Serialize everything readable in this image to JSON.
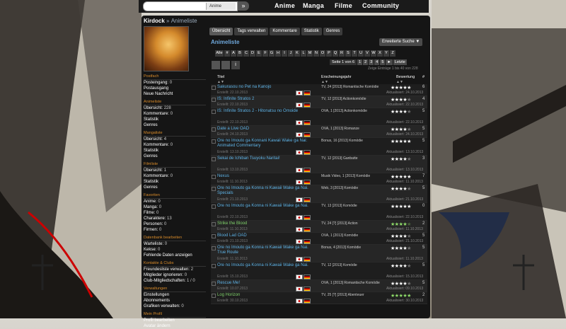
{
  "search": {
    "select_value": "Anime",
    "button_icon": "double-chevron-right-icon"
  },
  "nav": {
    "items": [
      "Anime",
      "Manga",
      "Filme",
      "Community"
    ]
  },
  "user": {
    "name": "Kirdock",
    "separator": "»",
    "page": "Animeliste"
  },
  "sidebar": {
    "sections": [
      {
        "title": "Postfach",
        "lines": [
          {
            "label": "Posteingang:",
            "value": "0"
          },
          {
            "label": "Postausgang",
            "value": ""
          },
          {
            "label": "Neue Nachricht",
            "value": ""
          }
        ]
      },
      {
        "title": "Animeliste",
        "lines": [
          {
            "label": "Übersicht:",
            "value": "228"
          },
          {
            "label": "Kommentare:",
            "value": "0"
          },
          {
            "label": "Statistik",
            "value": ""
          },
          {
            "label": "Genres",
            "value": ""
          }
        ]
      },
      {
        "title": "Mangaliste",
        "lines": [
          {
            "label": "Übersicht:",
            "value": "4"
          },
          {
            "label": "Kommentare:",
            "value": "0"
          },
          {
            "label": "Statistik",
            "value": ""
          },
          {
            "label": "Genres",
            "value": ""
          }
        ]
      },
      {
        "title": "Filmliste",
        "lines": [
          {
            "label": "Übersicht:",
            "value": "1"
          },
          {
            "label": "Kommentare:",
            "value": "0"
          },
          {
            "label": "Statistik",
            "value": ""
          },
          {
            "label": "Genres",
            "value": ""
          }
        ]
      },
      {
        "title": "Favoriten",
        "lines": [
          {
            "label": "Anime:",
            "value": "0"
          },
          {
            "label": "Manga:",
            "value": "0"
          },
          {
            "label": "Filme:",
            "value": "0"
          },
          {
            "label": "Charaktere:",
            "value": "13"
          },
          {
            "label": "Personen:",
            "value": "0"
          },
          {
            "label": "Firmen:",
            "value": "0"
          }
        ]
      },
      {
        "title": "Datenbank bearbeiten",
        "lines": [
          {
            "label": "Warteliste:",
            "value": "0"
          },
          {
            "label": "Kekse:",
            "value": "0"
          },
          {
            "label": "Fehlende Daten anzeigen",
            "value": ""
          }
        ]
      },
      {
        "title": "Kontakte & Clubs",
        "lines": [
          {
            "label": "Freundesliste verwalten:",
            "value": "2"
          },
          {
            "label": "Mitglieder ignorieren:",
            "value": "0"
          },
          {
            "label": "Club-Mitgliedschaften:",
            "value": "1 / 0"
          }
        ]
      },
      {
        "title": "Verwaltungen",
        "lines": [
          {
            "label": "Einstellungen",
            "value": ""
          },
          {
            "label": "Abonnements",
            "value": ""
          },
          {
            "label": "Grafiken verwalten:",
            "value": "0"
          }
        ]
      },
      {
        "title": "Mein Profil",
        "lines": [
          {
            "label": "Profil bearbeiten",
            "value": ""
          },
          {
            "label": "Avatar ändern",
            "value": ""
          }
        ]
      }
    ]
  },
  "tabs": [
    "Übersicht",
    "Tags verwalten",
    "Kommentare",
    "Statistik",
    "Genres"
  ],
  "heading": "Animeliste",
  "advanced_search": "Erweiterte Suche ▼",
  "letters": [
    "Alle",
    "#",
    "A",
    "B",
    "C",
    "D",
    "E",
    "F",
    "G",
    "H",
    "I",
    "J",
    "K",
    "L",
    "M",
    "N",
    "O",
    "P",
    "Q",
    "R",
    "S",
    "T",
    "U",
    "V",
    "W",
    "X",
    "Y",
    "Z"
  ],
  "pager": {
    "label": "Seite 1 von 6",
    "pages": [
      "1",
      "2",
      "3",
      "4",
      "5"
    ],
    "next": "►",
    "last": "Letzte"
  },
  "entries_info": "Zeige Einträge 1 bis 40 von 228",
  "table_headers": {
    "title": "Titel",
    "release": "Erscheinungsjahr",
    "rating": "Bewertung",
    "num": "#"
  },
  "rows": [
    {
      "title": "Sakurasou no Pet na Kanojo",
      "meta": "Erstellt: 22.10.2013",
      "info": "TV, 24 [2013] Romantische Komödie",
      "stars": 5,
      "num": "6",
      "updated": "Aktualisiert: 24.10.2013",
      "green": false
    },
    {
      "title": "IS: Infinite Stratos 2",
      "meta": "Erstellt: 22.10.2013",
      "info": "TV, 12 [2013] Actionkomödie",
      "stars": 4,
      "num": "4",
      "updated": "Aktualisiert: 22.10.2013",
      "green": false
    },
    {
      "title": "IS: Infinite Stratos 2 - Hitonatsu no Omoide",
      "meta": "Erstellt: 22.10.2013",
      "info": "OVA, 1 [2013] Actionkomödie",
      "stars": 4,
      "num": "5",
      "updated": "Aktualisiert: 22.10.2013",
      "green": false
    },
    {
      "title": "Date a Live OAD",
      "meta": "Erstellt: 24.10.2013",
      "info": "OVA, 1 [2013] Romanze",
      "stars": 4,
      "num": "5",
      "updated": "Aktualisiert: 24.10.2013",
      "green": false
    },
    {
      "title": "Ore no Imouto ga Konnani Kawaii Wake ga Nai: Animated Commentary",
      "meta": "Erstellt: 13.10.2013",
      "info": "Bonus, 16 [2013] Komödie",
      "stars": 5,
      "num": "5",
      "updated": "Aktualisiert: 13.10.2013",
      "green": false
    },
    {
      "title": "Sekai de Ichiban Tsuyoku Naritai!",
      "meta": "Erstellt: 13.10.2013",
      "info": "TV, 12 [2013] Ganbatte",
      "stars": 4,
      "num": "3",
      "updated": "Aktualisiert: 13.10.2013",
      "green": false
    },
    {
      "title": "Nexus",
      "meta": "Erstellt: 11.10.2013",
      "info": "Musik Video, 1 [2013] Komödie",
      "stars": 5,
      "num": "7",
      "updated": "Aktualisiert: 11.10.2013",
      "green": false
    },
    {
      "title": "Ore no Imouto ga Konna ni Kawaii Wake ga Nai. Specials",
      "meta": "Erstellt: 21.10.2013",
      "info": "Web, 3 [2013] Komödie",
      "stars": 4,
      "num": "5",
      "updated": "Aktualisiert: 21.10.2013",
      "green": false
    },
    {
      "title": "Ore no Imouto ga Konna ni Kawaii Wake ga Nai.",
      "meta": "Erstellt: 22.10.2013",
      "info": "TV, 13 [2013] Komödie",
      "stars": 5,
      "num": "0",
      "updated": "Aktualisiert: 22.10.2013",
      "green": false
    },
    {
      "title": "Strike the Blood",
      "meta": "Erstellt: 11.10.2013",
      "info": "TV, 24 [?] [2013] Action",
      "stars": 4,
      "num": "2",
      "updated": "Aktualisiert: 11.10.2013",
      "green": true
    },
    {
      "title": "Blood Lad OAD",
      "meta": "Erstellt: 21.10.2013",
      "info": "OVA, 1 [2013] Komödie",
      "stars": 4,
      "num": "5",
      "updated": "Aktualisiert: 21.10.2013",
      "green": false
    },
    {
      "title": "Ore no Imouto ga Konna ni Kawaii Wake ga Nai. True Route",
      "meta": "Erstellt: 11.10.2013",
      "info": "Bonus, 4 [2013] Komödie",
      "stars": 4,
      "num": "5",
      "updated": "Aktualisiert: 11.10.2013",
      "green": false
    },
    {
      "title": "Ore no Imouto ga Konna ni Kawaii Wake ga Nai.",
      "meta": "Erstellt: 15.10.2013",
      "info": "TV, 12 [2013] Komödie",
      "stars": 4,
      "num": "5",
      "updated": "Aktualisiert: 15.10.2013",
      "green": false
    },
    {
      "title": "Rescue Me!",
      "meta": "Erstellt: 10.07.2013",
      "info": "OVA, 1 [2013] Romantische Komödie",
      "stars": 4,
      "num": "5",
      "updated": "Aktualisiert: 09.10.2013",
      "green": false
    },
    {
      "title": "Log Horizon",
      "meta": "Erstellt: 30.10.2013",
      "info": "TV, 25 [?] [2013] Abenteuer",
      "stars": 5,
      "num": "2",
      "updated": "Aktualisiert: 30.10.2013",
      "green": true
    }
  ]
}
